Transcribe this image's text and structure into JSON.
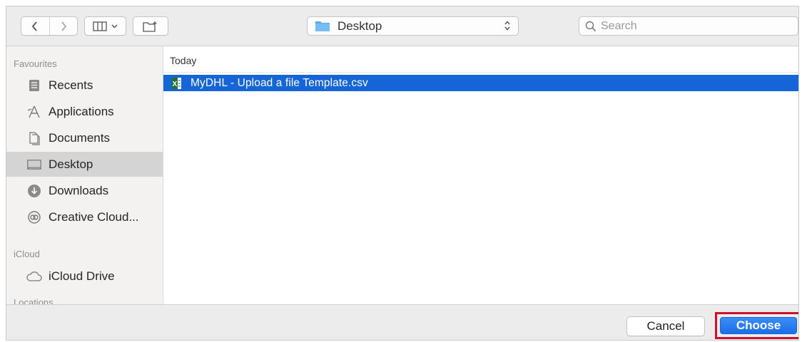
{
  "toolbar": {
    "back_icon": "chevron-left-icon",
    "forward_icon": "chevron-right-icon",
    "view_icon": "column-view-icon",
    "new_folder_icon": "new-folder-icon",
    "location": "Desktop",
    "search_placeholder": "Search"
  },
  "sidebar": {
    "favourites_header": "Favourites",
    "items": [
      {
        "label": "Recents",
        "icon": "recents-icon"
      },
      {
        "label": "Applications",
        "icon": "applications-icon"
      },
      {
        "label": "Documents",
        "icon": "documents-icon"
      },
      {
        "label": "Desktop",
        "icon": "desktop-icon",
        "selected": true
      },
      {
        "label": "Downloads",
        "icon": "downloads-icon"
      },
      {
        "label": "Creative Cloud...",
        "icon": "creative-cloud-icon"
      }
    ],
    "icloud_header": "iCloud",
    "icloud_items": [
      {
        "label": "iCloud Drive",
        "icon": "icloud-drive-icon"
      }
    ],
    "locations_header": "Locations"
  },
  "filelist": {
    "group_header": "Today",
    "files": [
      {
        "name": "MyDHL - Upload a file Template.csv",
        "icon": "excel-file-icon",
        "selected": true
      }
    ]
  },
  "footer": {
    "cancel_label": "Cancel",
    "choose_label": "Choose"
  },
  "colors": {
    "selection": "#1565d8",
    "primary_button": "#1b6fe8",
    "highlight_border": "#d0102a",
    "sidebar_bg": "#f3f2f0",
    "toolbar_bg": "#ececec"
  }
}
